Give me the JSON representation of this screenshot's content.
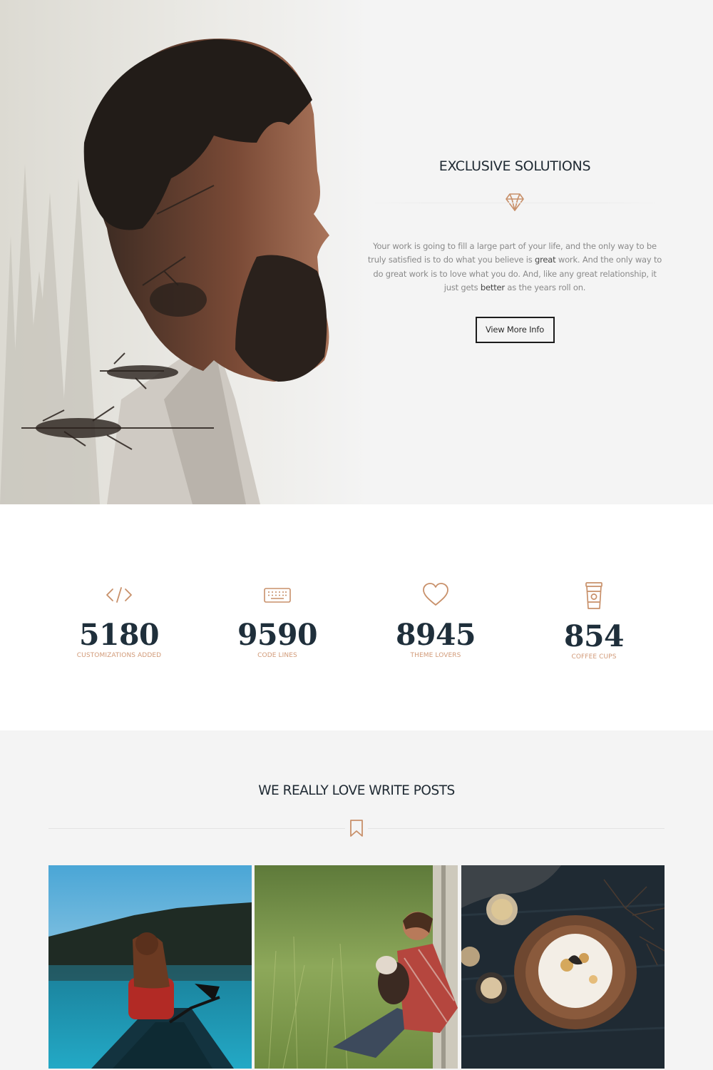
{
  "hero": {
    "title": "EXCLUSIVE SOLUTIONS",
    "icon": "diamond-icon",
    "text_parts": [
      "Your work is going to fill a large part of your life, and the only way to be truly satisfied is to do what you believe is ",
      "great",
      " work. And the only way to do great work is to love what you do. And, like any great relationship, it just gets ",
      "better",
      " as the years roll on."
    ],
    "button_label": "View More Info",
    "image": "double-exposure-bearded-man-forest"
  },
  "stats": [
    {
      "icon": "code-icon",
      "value": "5180",
      "label": "CUSTOMIZATIONS ADDED"
    },
    {
      "icon": "keyboard-icon",
      "value": "9590",
      "label": "CODE LINES"
    },
    {
      "icon": "heart-icon",
      "value": "8945",
      "label": "THEME LOVERS"
    },
    {
      "icon": "coffee-cup-icon",
      "value": "854",
      "label": "COFFEE CUPS"
    }
  ],
  "posts": {
    "title": "WE REALLY LOVE WRITE POSTS",
    "icon": "bookmark-icon",
    "items": [
      {
        "image": "woman-canoe-lake"
      },
      {
        "image": "man-with-dog-in-grass"
      },
      {
        "image": "cake-on-wooden-table"
      }
    ]
  },
  "colors": {
    "accent": "#c8906a",
    "dark": "#1f2f3b",
    "hero_bg": "#f4f4f4"
  }
}
